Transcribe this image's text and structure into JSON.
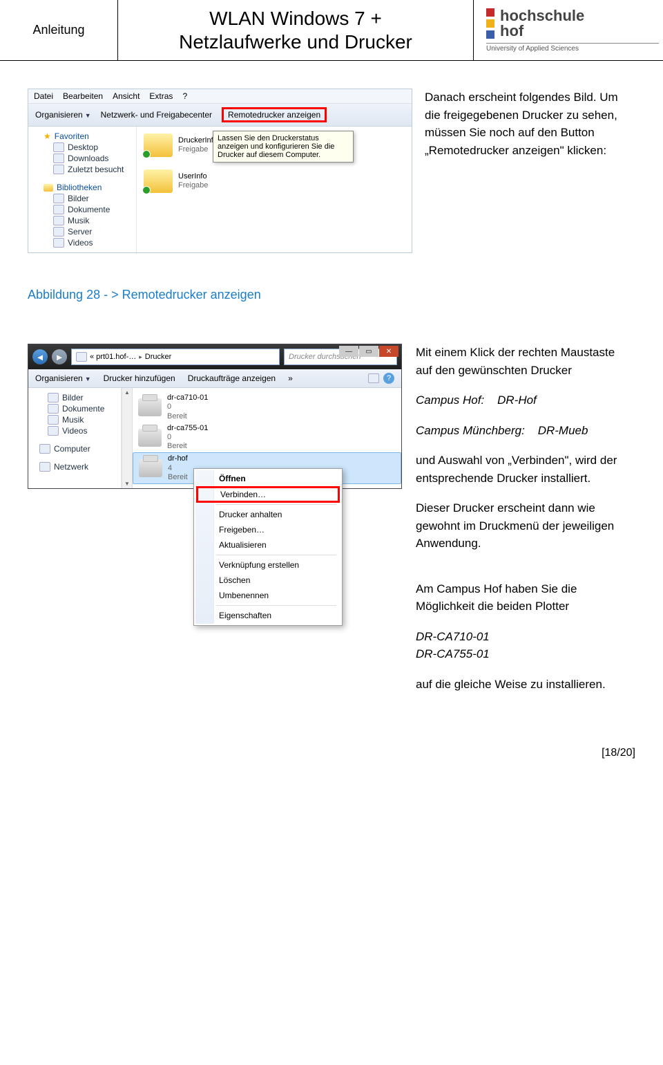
{
  "header": {
    "left": "Anleitung",
    "title_line1": "WLAN Windows 7 +",
    "title_line2": "Netzlaufwerke und Drucker",
    "logo_name": "hochschule",
    "logo_name2": "hof",
    "logo_sub": "University of Applied Sciences"
  },
  "exp1": {
    "menu": {
      "datei": "Datei",
      "bearbeiten": "Bearbeiten",
      "ansicht": "Ansicht",
      "extras": "Extras",
      "help": "?"
    },
    "toolbar": {
      "organisieren": "Organisieren",
      "center": "Netzwerk- und Freigabecenter",
      "remote": "Remotedrucker anzeigen"
    },
    "nav": {
      "fav": "Favoriten",
      "desktop": "Desktop",
      "downloads": "Downloads",
      "zuletzt": "Zuletzt besucht",
      "bib": "Bibliotheken",
      "bilder": "Bilder",
      "doku": "Dokumente",
      "musik": "Musik",
      "server": "Server",
      "videos": "Videos"
    },
    "folders": {
      "f1": "DruckerInfo",
      "f1b": "Freigabe",
      "f2": "UserInfo",
      "f2b": "Freigabe"
    },
    "tooltip": {
      "l1": "Lassen Sie den Druckerstatus",
      "l2": "anzeigen und konfigurieren Sie die",
      "l3": "Drucker auf diesem Computer."
    }
  },
  "side1": {
    "p1": "Danach erscheint folgendes Bild. Um die freigegebenen Drucker zu sehen, müssen Sie noch auf den Button „Remotedrucker anzeigen\" klicken:"
  },
  "caption1": "Abbildung 28 - > Remotedrucker anzeigen",
  "exp2": {
    "addr_prefix": "« prt01.hof-…",
    "addr_sep": "▸",
    "addr_last": "Drucker",
    "search_ph": "Drucker durchsuchen",
    "win_min": "—",
    "win_max": "▭",
    "win_close": "✕",
    "toolbar": {
      "organisieren": "Organisieren",
      "hinzu": "Drucker hinzufügen",
      "auftrag": "Druckaufträge anzeigen",
      "more": "»"
    },
    "nav": {
      "bilder": "Bilder",
      "doku": "Dokumente",
      "musik": "Musik",
      "videos": "Videos",
      "computer": "Computer",
      "netzwerk": "Netzwerk"
    },
    "printers": {
      "p1_name": "dr-ca710-01",
      "p1_jobs": "0",
      "p1_status": "Bereit",
      "p2_name": "dr-ca755-01",
      "p2_jobs": "0",
      "p2_status": "Bereit",
      "p3_name": "dr-hof",
      "p3_jobs": "4",
      "p3_status": "Bereit"
    }
  },
  "ctx": {
    "oeffnen": "Öffnen",
    "verbinden": "Verbinden…",
    "anhalten": "Drucker anhalten",
    "freigeben": "Freigeben…",
    "aktualisieren": "Aktualisieren",
    "verknuepfung": "Verknüpfung erstellen",
    "loeschen": "Löschen",
    "umbenennen": "Umbenennen",
    "eigenschaften": "Eigenschaften"
  },
  "side2": {
    "p1": "Mit einem Klick der rechten Maustaste auf den gewünschten Drucker",
    "hof_label": "Campus Hof:",
    "hof_val": "DR-Hof",
    "mueb_label": "Campus Münchberg:",
    "mueb_val": "DR-Mueb",
    "p2": "und Auswahl von „Verbinden\", wird der entsprechende Drucker installiert.",
    "p3": "Dieser Drucker erscheint dann wie gewohnt im Druckmenü der jeweiligen Anwendung.",
    "p4": "Am Campus Hof haben Sie die Möglichkeit die beiden Plotter",
    "pl1": "DR-CA710-01",
    "pl2": "DR-CA755-01",
    "p5": "auf die gleiche Weise zu installieren."
  },
  "footer": "[18/20]"
}
